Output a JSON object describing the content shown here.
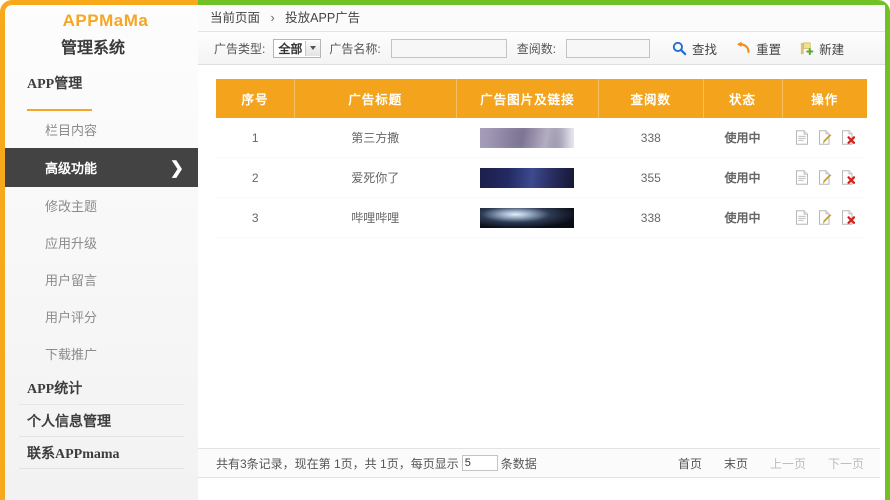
{
  "sidebar": {
    "brand_title": "APPMaMa",
    "brand_sub": "管理系统",
    "group_app": "APP管理",
    "items": [
      {
        "label": "栏目内容"
      },
      {
        "label": "高级功能",
        "chevron": "❯"
      },
      {
        "label": "修改主题"
      },
      {
        "label": "应用升级"
      },
      {
        "label": "用户留言"
      },
      {
        "label": "用户评分"
      },
      {
        "label": "下载推广"
      }
    ],
    "group_stats": "APP统计",
    "group_profile": "个人信息管理",
    "group_contact": "联系APPmama"
  },
  "breadcrumb": {
    "current": "当前页面",
    "separator": "›",
    "page": "投放APP广告"
  },
  "toolbar": {
    "type_label": "广告类型:",
    "type_value": "全部",
    "name_label": "广告名称:",
    "name_value": "",
    "views_label": "查阅数:",
    "views_value": "",
    "search_label": "查找",
    "reset_label": "重置",
    "new_label": "新建"
  },
  "table": {
    "headers": [
      "序号",
      "广告标题",
      "广告图片及链接",
      "查阅数",
      "状态",
      "操作"
    ],
    "rows": [
      {
        "idx": "1",
        "title": "第三方撒",
        "thumb": "t1",
        "views": "338",
        "status": "使用中"
      },
      {
        "idx": "2",
        "title": "爱死你了",
        "thumb": "t2",
        "views": "355",
        "status": "使用中"
      },
      {
        "idx": "3",
        "title": "哔哩哔哩",
        "thumb": "t3",
        "views": "338",
        "status": "使用中"
      }
    ],
    "ops": [
      "view-icon",
      "edit-icon",
      "delete-icon"
    ]
  },
  "footer": {
    "total_text": "共有3条记录，现在第 1页，共 1页，每页显示",
    "page_size": "5",
    "unit_text": "条数据",
    "first": "首页",
    "last": "末页",
    "prev": "上一页",
    "next": "下一页"
  },
  "colors": {
    "accent_orange": "#f3a41c",
    "accent_green": "#6fc125",
    "status_blue": "#1f3fbf",
    "active_bg": "#434343"
  }
}
